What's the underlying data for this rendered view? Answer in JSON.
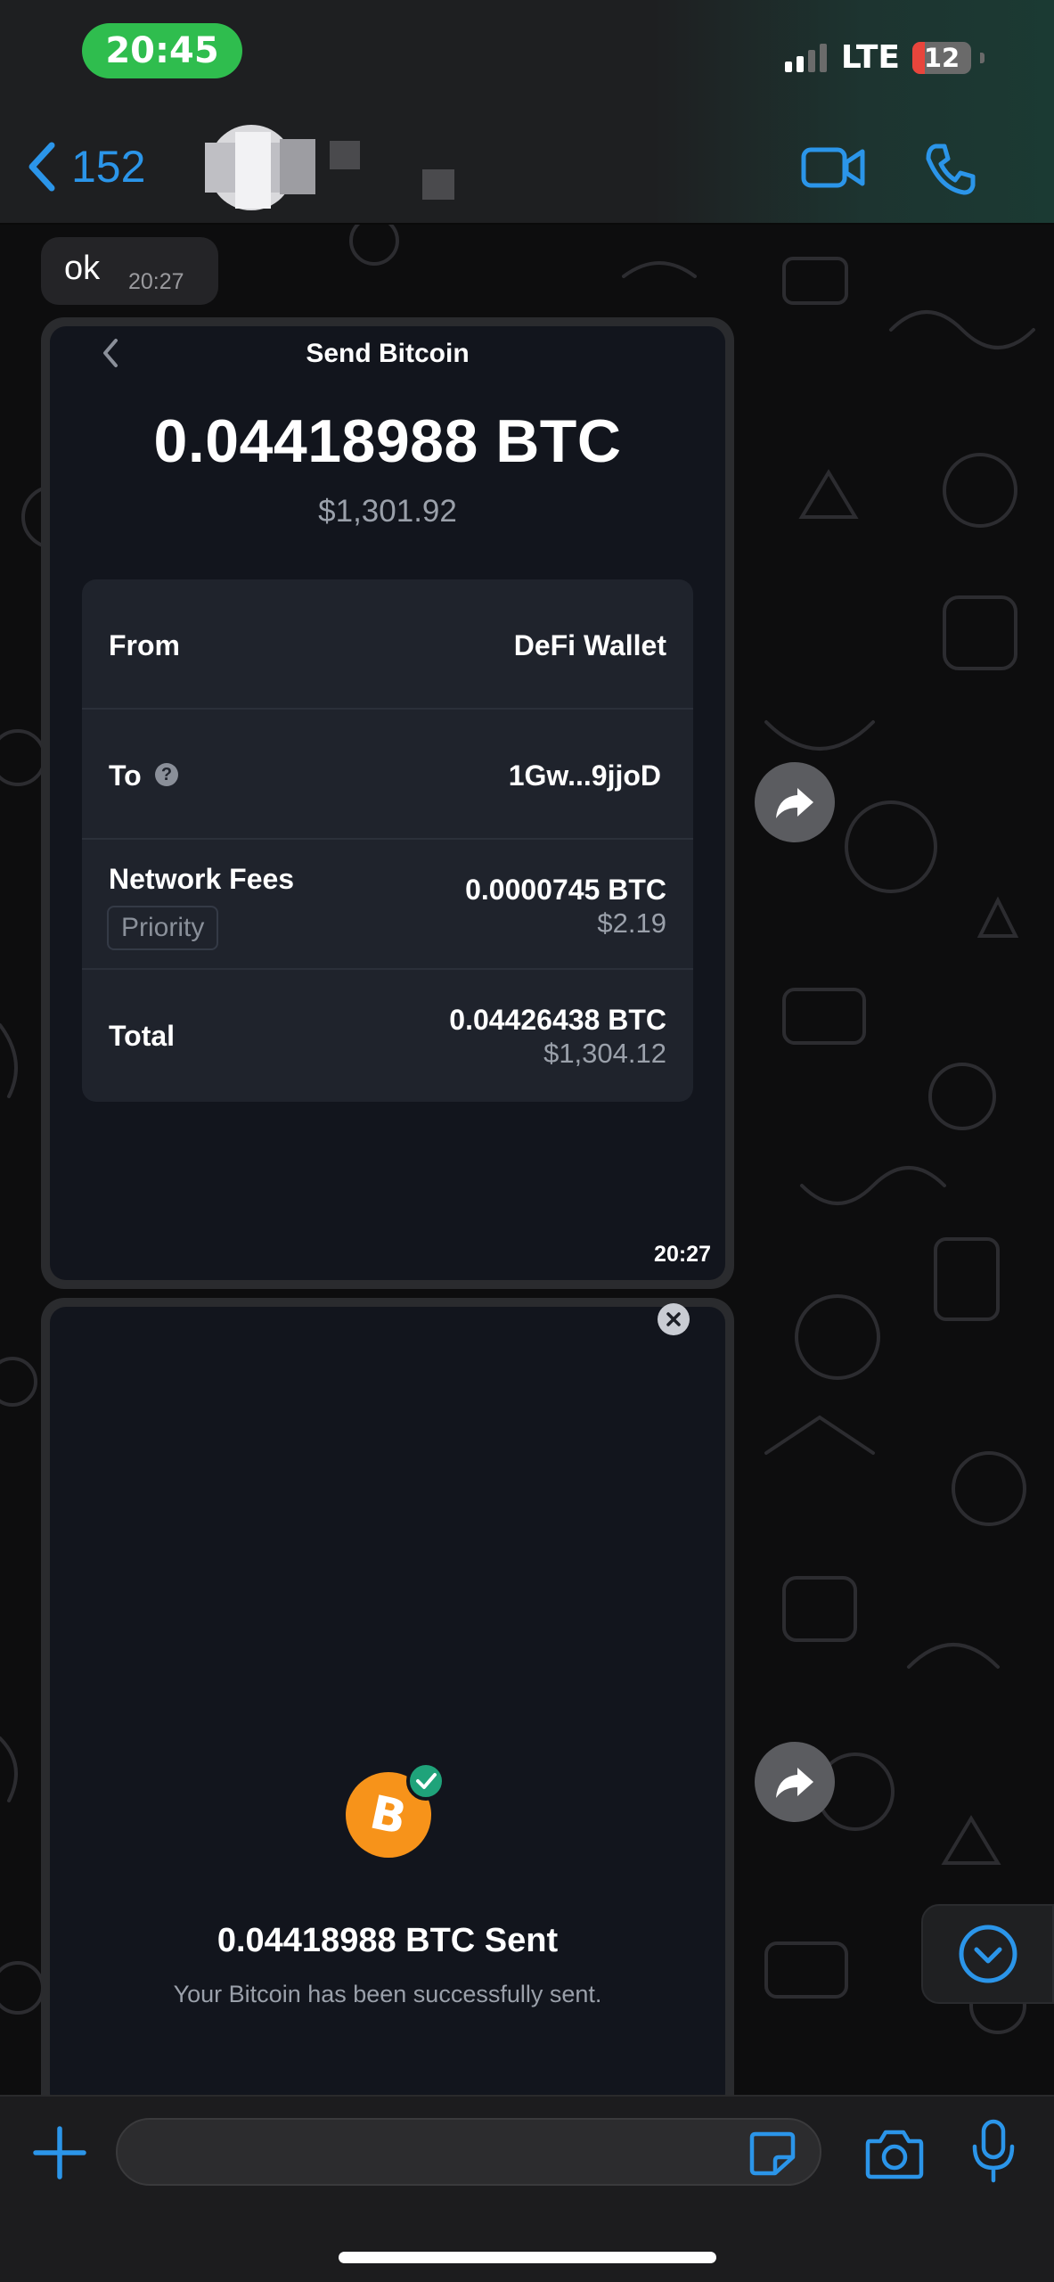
{
  "status_bar": {
    "time": "20:45",
    "network": "LTE",
    "battery": "12"
  },
  "header": {
    "back_count": "152"
  },
  "messages": {
    "ok": {
      "text": "ok",
      "time": "20:27"
    },
    "send_screenshot": {
      "title": "Send Bitcoin",
      "amount": "0.04418988 BTC",
      "amount_usd": "$1,301.92",
      "from_label": "From",
      "from_value": "DeFi Wallet",
      "to_label": "To",
      "to_help": "?",
      "to_value": "1Gw...9jjoD",
      "fees_label": "Network Fees",
      "fees_tag": "Priority",
      "fees_btc": "0.0000745 BTC",
      "fees_usd": "$2.19",
      "total_label": "Total",
      "total_btc": "0.04426438 BTC",
      "total_usd": "$1,304.12",
      "time": "20:27"
    },
    "sent_screenshot": {
      "title": "0.04418988 BTC Sent",
      "subtitle": "Your Bitcoin has been successfully sent."
    }
  },
  "icons": [
    "chevron-left-icon",
    "video-call-icon",
    "phone-icon",
    "share-forward-icon",
    "close-icon",
    "bitcoin-icon",
    "check-icon",
    "chevron-down-icon",
    "plus-icon",
    "sticker-icon",
    "camera-icon",
    "microphone-icon"
  ],
  "colors": {
    "accent": "#2b95e9",
    "clock_pill": "#2fbd4e",
    "bitcoin": "#f7931a",
    "check": "#1fa37a",
    "battery_low": "#e8453c"
  }
}
